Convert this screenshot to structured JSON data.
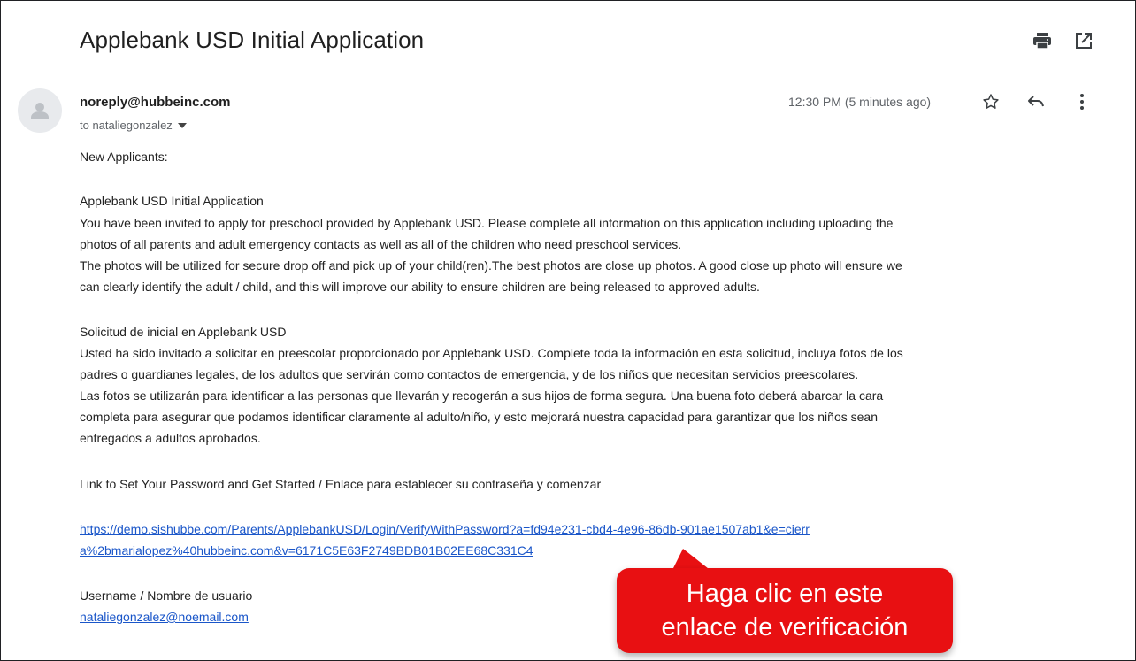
{
  "email": {
    "subject": "Applebank USD Initial Application",
    "sender": "noreply@hubbeinc.com",
    "recipient": "to nataliegonzalez",
    "timestamp": "12:30 PM (5 minutes ago)"
  },
  "icons": {
    "print": "printer-icon",
    "popout": "open-in-new-window-icon",
    "avatar": "person-avatar-icon",
    "star": "star-outline-icon",
    "reply": "reply-arrow-icon",
    "more": "more-vertical-icon",
    "recipient_dropdown": "caret-down-icon"
  },
  "body": {
    "greeting": "New Applicants:",
    "en_title": "Applebank USD Initial Application",
    "en_l1": "You have been invited to apply for preschool provided by Applebank USD. Please complete all information on this application including uploading the",
    "en_l2": "photos of all parents and adult emergency contacts as well as all of the children who need preschool services.",
    "en_l3": "The photos will be utilized for secure drop off and pick up of your child(ren).The best photos are close up photos. A good close up photo will ensure we",
    "en_l4": "can clearly identify the adult / child, and this will improve our ability to ensure children are being released to approved adults.",
    "es_title": "Solicitud de inicial en Applebank USD",
    "es_l1": "Usted ha sido invitado a solicitar en preescolar proporcionado por Applebank USD. Complete toda la información en esta solicitud, incluya fotos de los",
    "es_l2": "padres o guardianes legales, de los adultos que servirán como contactos de emergencia, y de los niños que necesitan servicios preescolares.",
    "es_l3": "Las fotos se utilizarán para identificar a las personas que llevarán y recogerán a sus hijos de forma segura. Una buena foto deberá abarcar la cara",
    "es_l4": "completa para asegurar que podamos identificar claramente al adulto/niño, y esto mejorará nuestra capacidad para garantizar que los niños sean",
    "es_l5": "entregados a adultos aprobados.",
    "link_intro": "Link to Set Your Password and Get Started / Enlace para establecer su contraseña y comenzar",
    "link_l1": "https://demo.sishubbe.com/Parents/ApplebankUSD/Login/VerifyWithPassword?a=fd94e231-cbd4-4e96-86db-901ae1507ab1&e=cierr",
    "link_l2": "a%2bmarialopez%40hubbeinc.com&v=6171C5E63F2749BDB01B02EE68C331C4",
    "username_label": "Username / Nombre de usuario",
    "username_value": "nataliegonzalez@noemail.com"
  },
  "callout": {
    "line1": "Haga clic en este",
    "line2": "enlace de verificación",
    "color": "#e81012"
  }
}
